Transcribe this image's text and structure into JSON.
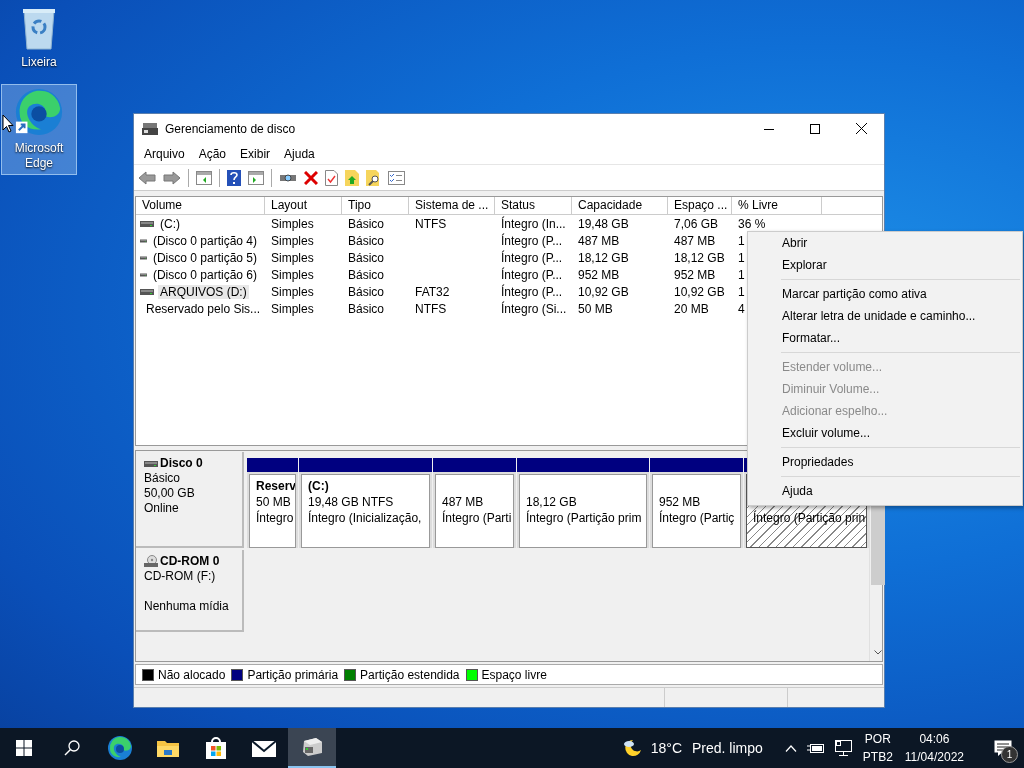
{
  "desktop_icons": [
    {
      "kind": "recycle-bin",
      "label": "Lixeira",
      "selected": false
    },
    {
      "kind": "edge",
      "label": "Microsoft Edge",
      "selected": true
    }
  ],
  "window": {
    "title": "Gerenciamento de disco"
  },
  "menu_bar": [
    "Arquivo",
    "Ação",
    "Exibir",
    "Ajuda"
  ],
  "volume_table": {
    "columns": [
      "Volume",
      "Layout",
      "Tipo",
      "Sistema de ...",
      "Status",
      "Capacidade",
      "Espaço ...",
      "% Livre"
    ],
    "rows": [
      {
        "selected": false,
        "cells": [
          "(C:)",
          "Simples",
          "Básico",
          "NTFS",
          "Íntegro (In...",
          "19,48 GB",
          "7,06 GB",
          "36 %"
        ]
      },
      {
        "selected": false,
        "cells": [
          "(Disco 0 partição 4)",
          "Simples",
          "Básico",
          "",
          "Íntegro (P...",
          "487 MB",
          "487 MB",
          "1"
        ]
      },
      {
        "selected": false,
        "cells": [
          "(Disco 0 partição 5)",
          "Simples",
          "Básico",
          "",
          "Íntegro (P...",
          "18,12 GB",
          "18,12 GB",
          "1"
        ]
      },
      {
        "selected": false,
        "cells": [
          "(Disco 0 partição 6)",
          "Simples",
          "Básico",
          "",
          "Íntegro (P...",
          "952 MB",
          "952 MB",
          "1"
        ]
      },
      {
        "selected": true,
        "cells": [
          "ARQUIVOS (D:)",
          "Simples",
          "Básico",
          "FAT32",
          "Íntegro (P...",
          "10,92 GB",
          "10,92 GB",
          "1"
        ]
      },
      {
        "selected": false,
        "cells": [
          "Reservado pelo Sis...",
          "Simples",
          "Básico",
          "NTFS",
          "Íntegro (Si...",
          "50 MB",
          "20 MB",
          "4"
        ]
      }
    ]
  },
  "disks": [
    {
      "kind": "disk",
      "name": "Disco 0",
      "type": "Básico",
      "size": "50,00 GB",
      "status": "Online",
      "partitions": [
        {
          "name": "Reserv",
          "size": "50 MB",
          "status": "Íntegro",
          "selected": false
        },
        {
          "name": "(C:)",
          "size": "19,48 GB NTFS",
          "status": "Íntegro (Inicialização, ",
          "selected": false
        },
        {
          "size": "487 MB",
          "status": "Íntegro (Parti",
          "selected": false
        },
        {
          "size": "18,12 GB",
          "status": "Íntegro (Partição prim",
          "selected": false
        },
        {
          "size": "952 MB",
          "status": "Íntegro (Partiç",
          "selected": false
        },
        {
          "status": "Íntegro (Partição prin",
          "selected": true
        }
      ]
    },
    {
      "kind": "cdrom",
      "name": "CD-ROM 0",
      "type": "CD-ROM (F:)",
      "media": "Nenhuma mídia"
    }
  ],
  "legend": [
    {
      "label": "Não alocado",
      "color": "#000000"
    },
    {
      "label": "Partição primária",
      "color": "#000080"
    },
    {
      "label": "Partição estendida",
      "color": "#008000"
    },
    {
      "label": "Espaço livre",
      "color": "#00ff00"
    }
  ],
  "context_menu": {
    "groups": [
      [
        {
          "label": "Abrir",
          "disabled": false
        },
        {
          "label": "Explorar",
          "disabled": false
        }
      ],
      [
        {
          "label": "Marcar partição como ativa",
          "disabled": false
        },
        {
          "label": "Alterar letra de unidade e caminho...",
          "disabled": false
        },
        {
          "label": "Formatar...",
          "disabled": false
        }
      ],
      [
        {
          "label": "Estender volume...",
          "disabled": true
        },
        {
          "label": "Diminuir Volume...",
          "disabled": true
        },
        {
          "label": "Adicionar espelho...",
          "disabled": true
        },
        {
          "label": "Excluir volume...",
          "disabled": false
        }
      ],
      [
        {
          "label": "Propriedades",
          "disabled": false
        }
      ],
      [
        {
          "label": "Ajuda",
          "disabled": false
        }
      ]
    ]
  },
  "taskbar": {
    "apps": [
      {
        "kind": "edge",
        "selected": false
      },
      {
        "kind": "explorer",
        "selected": false
      },
      {
        "kind": "store",
        "selected": false
      },
      {
        "kind": "mail",
        "selected": false
      },
      {
        "kind": "disk-management",
        "selected": true
      }
    ],
    "weather": {
      "temperature": "18°C",
      "condition": "Pred. limpo"
    },
    "language": {
      "code": "POR",
      "layout": "PTB2"
    },
    "clock": {
      "time": "04:06",
      "date": "11/04/2022"
    },
    "notifications": "1"
  }
}
